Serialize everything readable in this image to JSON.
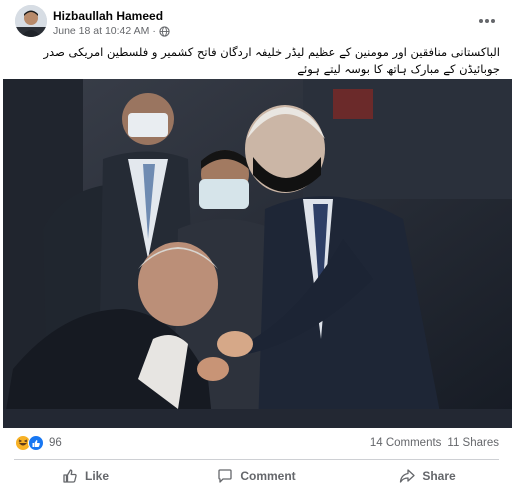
{
  "post": {
    "author": "Hizbaullah Hameed",
    "timestamp": "June 18 at 10:42 AM",
    "separator": "·",
    "visibility_icon": "globe-icon",
    "more_icon": "more-options-icon",
    "caption": "الباکستانی منافقین اور مومنین کے عظیم لیڈر خلیفہ اردگان فاتح کشمیر و فلسطین امریکی صدر جوبائیڈن کے مبارک ہاتھ کا بوسہ لیتے ہوئے"
  },
  "reactions": {
    "icons": [
      "haha-icon",
      "like-icon"
    ],
    "count": "96",
    "comments": "14 Comments",
    "shares": "11 Shares"
  },
  "actions": {
    "like_label": "Like",
    "comment_label": "Comment",
    "share_label": "Share"
  },
  "colors": {
    "text_primary": "#050505",
    "text_secondary": "#65676b",
    "like_blue": "#1877f2",
    "haha_yellow": "#f7b125",
    "divider": "#ced0d4"
  }
}
